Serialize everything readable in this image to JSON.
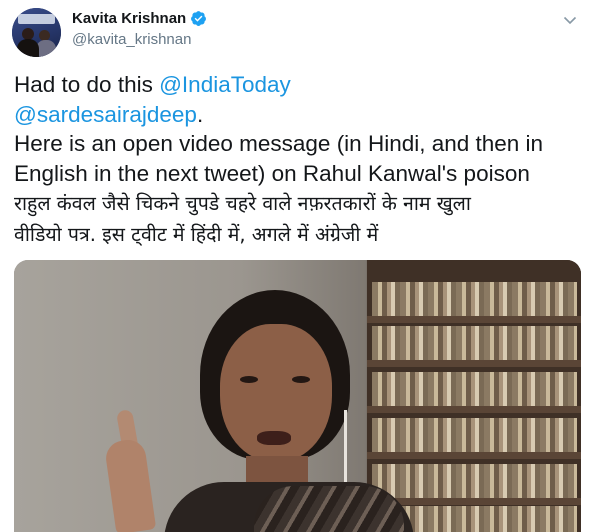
{
  "tweet": {
    "author": {
      "name": "Kavita Krishnan",
      "handle": "@kavita_krishnan",
      "verified": true,
      "avatar_icon": "profile-photo"
    },
    "menu_icon": "chevron-down-icon",
    "text_lines": [
      {
        "parts": [
          {
            "text": "Had to do this ",
            "type": "plain"
          },
          {
            "text": "@IndiaToday",
            "type": "mention"
          }
        ]
      },
      {
        "parts": [
          {
            "text": "@sardesairajdeep",
            "type": "mention"
          },
          {
            "text": ".",
            "type": "plain"
          }
        ]
      },
      {
        "parts": [
          {
            "text": "Here is an open video message (in Hindi, and then in",
            "type": "plain"
          }
        ]
      },
      {
        "parts": [
          {
            "text": "English in the next tweet) on Rahul Kanwal's poison",
            "type": "plain"
          }
        ]
      },
      {
        "parts": [
          {
            "text": "राहुल कंवल जैसे चिकने चुपडे चहरे वाले नफ़रतकारों के नाम खुला",
            "type": "hindi"
          }
        ]
      },
      {
        "parts": [
          {
            "text": "वीडियो पत्र. इस ट्वीट में हिंदी में, अगले में अंग्रेजी में",
            "type": "hindi"
          }
        ]
      }
    ],
    "media": {
      "type": "video",
      "description_icon": "video-thumbnail"
    },
    "colors": {
      "link": "#1b95e0",
      "text": "#14171a",
      "secondary": "#657786",
      "verified": "#1da1f2"
    }
  }
}
